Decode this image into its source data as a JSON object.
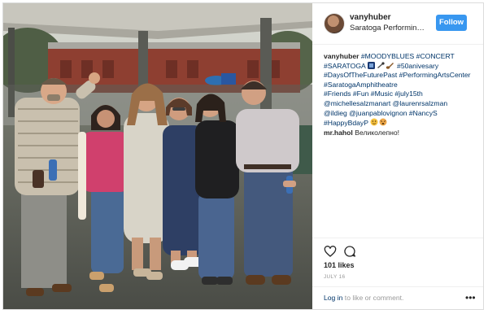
{
  "post": {
    "username": "vanyhuber",
    "location": "Saratoga Performing Ar...",
    "follow_label": "Follow",
    "caption": {
      "author": "vanyhuber",
      "lines": [
        "#MOODYBLUES #CONCERT",
        "#SARATOGA",
        "#50anivesary",
        "#DaysOfTheFuturePast #PerformingArtsCenter",
        "#SaratogaAmphitheatre",
        "#Friends #Fun #Music #july15th",
        "@michellesalzmanart @laurenrsalzman",
        "@ildieg @juanpablovignon #NancyS",
        "#HappyBdayP"
      ]
    },
    "comment": {
      "author": "mr.hahol",
      "text": "Великолепно!"
    },
    "likes": "101 likes",
    "date": "JULY 16",
    "comment_bar": {
      "login": "Log in",
      "rest": " to like or comment."
    },
    "icons": {
      "like": "heart-icon",
      "comment": "comment-icon",
      "more": "more-options-icon",
      "avatar": "profile-avatar"
    }
  },
  "colors": {
    "follow_blue": "#3897f0",
    "link_navy": "#003569",
    "muted_gray": "#999999",
    "border": "#dbdbdb"
  }
}
